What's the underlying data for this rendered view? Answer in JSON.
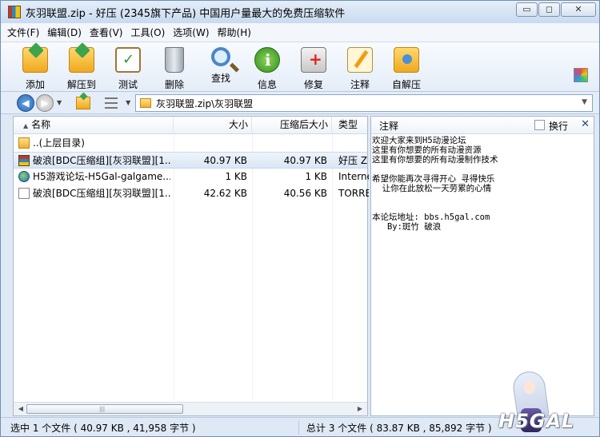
{
  "window": {
    "title": "灰羽联盟.zip - 好压 (2345旗下产品) 中国用户量最大的免费压缩软件",
    "minimize_glyph": "▭",
    "maximize_glyph": "◻",
    "close_glyph": "✕"
  },
  "menu": [
    "文件(F)",
    "编辑(D)",
    "查看(V)",
    "工具(O)",
    "选项(W)",
    "帮助(H)"
  ],
  "toolbar": {
    "items": [
      {
        "label": "添加",
        "icon": "add-folder-icon"
      },
      {
        "label": "解压到",
        "icon": "extract-folder-icon"
      },
      {
        "label": "测试",
        "icon": "test-clipboard-icon"
      },
      {
        "label": "删除",
        "icon": "trash-icon"
      },
      {
        "label": "查找",
        "icon": "search-icon"
      },
      {
        "label": "信息",
        "icon": "info-icon"
      },
      {
        "label": "修复",
        "icon": "repair-box-icon"
      },
      {
        "label": "注释",
        "icon": "comment-note-icon"
      },
      {
        "label": "自解压",
        "icon": "self-extract-icon"
      }
    ]
  },
  "address": {
    "path": "灰羽联盟.zip\\灰羽联盟"
  },
  "file_list": {
    "columns": {
      "name": "名称",
      "size": "大小",
      "packed": "压缩后大小",
      "type": "类型"
    },
    "rows": [
      {
        "name": "..(上层目录)",
        "size": "",
        "packed": "",
        "type": "",
        "icon": "folder",
        "selected": false
      },
      {
        "name": "破浪[BDC压缩组][灰羽联盟][1...",
        "size": "40.97 KB",
        "packed": "40.97 KB",
        "type": "好压 Z",
        "icon": "rar",
        "selected": true
      },
      {
        "name": "H5游戏论坛-H5Gal-galgame...",
        "size": "1 KB",
        "packed": "1 KB",
        "type": "Interne",
        "icon": "globe",
        "selected": false
      },
      {
        "name": "破浪[BDC压缩组][灰羽联盟][1...",
        "size": "42.62 KB",
        "packed": "40.56 KB",
        "type": "TORRE",
        "icon": "file",
        "selected": false
      }
    ]
  },
  "comment": {
    "title": "注释",
    "wrap_label": "换行",
    "close_glyph": "✕",
    "lines": [
      "欢迎大家来到H5动漫论坛",
      "这里有你想要的所有动漫资源",
      "这里有你想要的所有动漫制作技术",
      "",
      "希望你能再次寻得开心 寻得快乐",
      "  让你在此放松一天劳累的心情",
      "",
      "",
      "本论坛地址: bbs.h5gal.com",
      "   By:斑竹 破浪"
    ]
  },
  "status": {
    "left": "选中 1 个文件 ( 40.97 KB , 41,958 字节 )",
    "right": "总计 3 个文件 ( 83.87 KB , 85,892 字节 )"
  },
  "watermark": "H5GAL"
}
